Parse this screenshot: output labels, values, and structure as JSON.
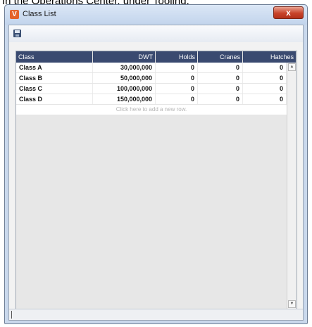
{
  "caption": {
    "text": "In the Operations Center, under Tooling,"
  },
  "window": {
    "title": "Class List",
    "app_icon": "veson-icon",
    "close_symbol": "x"
  },
  "toolbar": {
    "save_icon": "save-icon"
  },
  "grid": {
    "columns": [
      "Class",
      "DWT",
      "Holds",
      "Cranes",
      "Hatches"
    ],
    "rows": [
      [
        "Class A",
        "30,000,000",
        "0",
        "0",
        "0"
      ],
      [
        "Class B",
        "50,000,000",
        "0",
        "0",
        "0"
      ],
      [
        "Class C",
        "100,000,000",
        "0",
        "0",
        "0"
      ],
      [
        "Class D",
        "150,000,000",
        "0",
        "0",
        "0"
      ]
    ],
    "add_row_text": "Click here to add a new row.",
    "scroll_up": "▲",
    "scroll_down": "▼"
  },
  "colors": {
    "header_bg": "#3a4a70",
    "titlebar": "#c9d8ec",
    "close_button": "#c8432a"
  }
}
